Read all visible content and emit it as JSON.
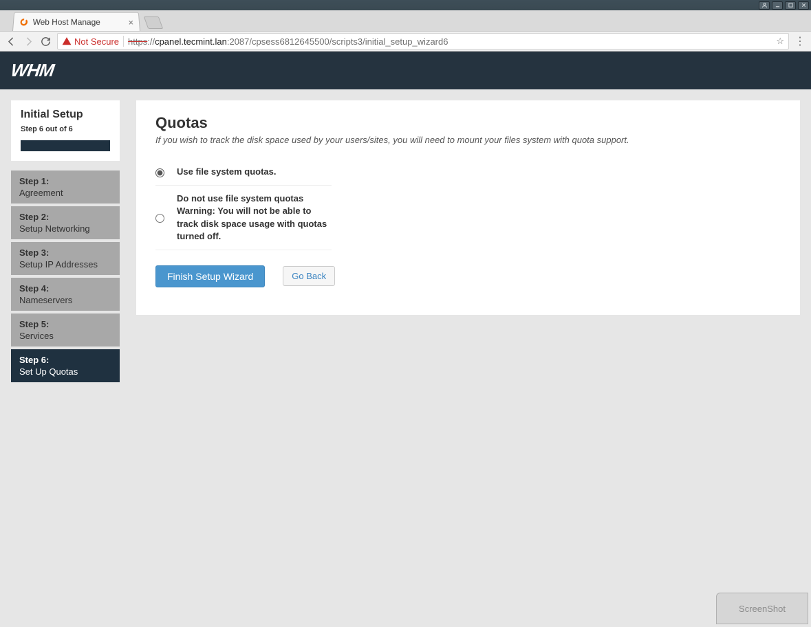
{
  "os": {
    "user_icon": "👤"
  },
  "browser": {
    "tab_title": "Web Host Manage",
    "not_secure": "Not Secure",
    "url_scheme": "https",
    "url_sep": "://",
    "url_host": "cpanel.tecmint.lan",
    "url_rest": ":2087/cpsess6812645500/scripts3/initial_setup_wizard6"
  },
  "topnav": {
    "logo": "WHM"
  },
  "sidebar": {
    "title": "Initial Setup",
    "subtitle": "Step 6 out of 6",
    "steps": [
      {
        "num": "Step 1:",
        "label": "Agreement"
      },
      {
        "num": "Step 2:",
        "label": "Setup Networking"
      },
      {
        "num": "Step 3:",
        "label": "Setup IP Addresses"
      },
      {
        "num": "Step 4:",
        "label": "Nameservers"
      },
      {
        "num": "Step 5:",
        "label": "Services"
      },
      {
        "num": "Step 6:",
        "label": "Set Up Quotas"
      }
    ]
  },
  "main": {
    "heading": "Quotas",
    "description": "If you wish to track the disk space used by your users/sites, you will need to mount your files system with quota support.",
    "option1": "Use file system quotas.",
    "option2_line1": "Do not use file system quotas",
    "option2_line2": "Warning: You will not be able to track disk space usage with quotas turned off.",
    "finish": "Finish Setup Wizard",
    "goback": "Go Back"
  },
  "badge": "ScreenShot"
}
